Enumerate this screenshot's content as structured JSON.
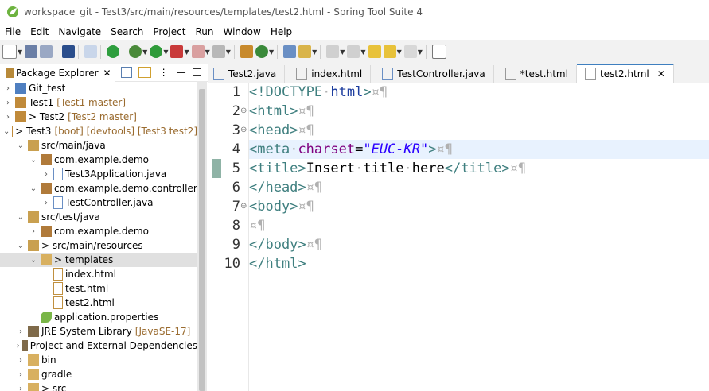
{
  "window": {
    "title": "workspace_git - Test3/src/main/resources/templates/test2.html - Spring Tool Suite 4"
  },
  "menu": [
    "File",
    "Edit",
    "Navigate",
    "Search",
    "Project",
    "Run",
    "Window",
    "Help"
  ],
  "explorer": {
    "tab_label": "Package Explorer",
    "tree": [
      {
        "label": "Git_test",
        "deco": ""
      },
      {
        "label": "Test1",
        "deco": "[Test1 master]"
      },
      {
        "label": "> Test2",
        "deco": "[Test2 master]"
      },
      {
        "label": "> Test3",
        "deco": "[boot] [devtools] [Test3 test2]"
      },
      {
        "label": "src/main/java",
        "deco": ""
      },
      {
        "label": "com.example.demo",
        "deco": ""
      },
      {
        "label": "Test3Application.java",
        "deco": ""
      },
      {
        "label": "com.example.demo.controller",
        "deco": ""
      },
      {
        "label": "TestController.java",
        "deco": ""
      },
      {
        "label": "src/test/java",
        "deco": ""
      },
      {
        "label": "com.example.demo",
        "deco": ""
      },
      {
        "label": "> src/main/resources",
        "deco": ""
      },
      {
        "label": "> templates",
        "deco": ""
      },
      {
        "label": "index.html",
        "deco": ""
      },
      {
        "label": "test.html",
        "deco": ""
      },
      {
        "label": "test2.html",
        "deco": ""
      },
      {
        "label": "application.properties",
        "deco": ""
      },
      {
        "label": "JRE System Library",
        "deco": "[JavaSE-17]"
      },
      {
        "label": "Project and External Dependencies",
        "deco": ""
      },
      {
        "label": "bin",
        "deco": ""
      },
      {
        "label": "gradle",
        "deco": ""
      },
      {
        "label": "> src",
        "deco": ""
      }
    ]
  },
  "editor": {
    "tabs": [
      "Test2.java",
      "index.html",
      "TestController.java",
      "*test.html",
      "test2.html"
    ],
    "active_tab": "test2.html",
    "line_numbers": [
      "1",
      "2",
      "3",
      "4",
      "5",
      "6",
      "7",
      "8",
      "9",
      "10"
    ],
    "lines": {
      "l1a": "<!DOCTYPE",
      "l1b": "html",
      "l1c": ">",
      "l2": "<html>",
      "l3": "<head>",
      "l4a": "<meta",
      "l4b": "charset",
      "l4c": "=",
      "l4d": "\"EUC-KR\"",
      "l4e": ">",
      "l5a": "<title>",
      "l5b": "Insert",
      "l5c": "title",
      "l5d": "here",
      "l5e": "</title>",
      "l6": "</head>",
      "l7": "<body>",
      "l9": "</body>",
      "l10": "</html>"
    },
    "ws": {
      "dot": "·",
      "eol": "¤¶"
    }
  }
}
